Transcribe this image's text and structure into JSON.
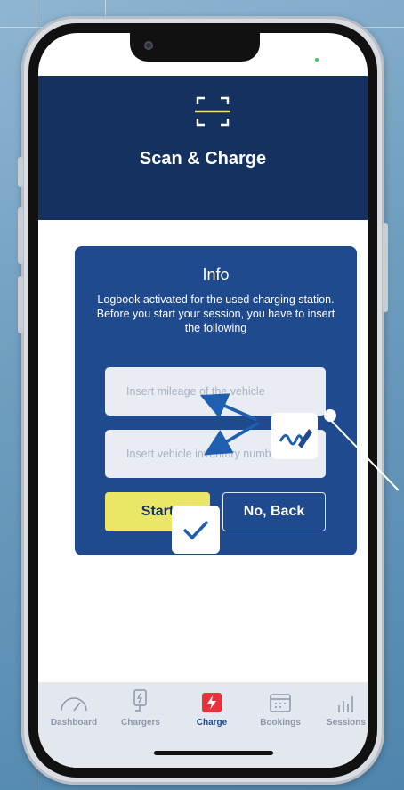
{
  "header": {
    "title": "Scan & Charge",
    "icon": "scan-frame-icon"
  },
  "card": {
    "title": "Info",
    "message": "Logbook activated for the used charging station. Before you start your session, you have to insert the following",
    "mileage_placeholder": "Insert mileage of the vehicle",
    "inventory_placeholder": "Insert vehicle inventory numb...",
    "start_label": "Start",
    "back_label": "No, Back"
  },
  "nav": {
    "items": [
      {
        "label": "Dashboard",
        "icon": "speedometer-icon"
      },
      {
        "label": "Chargers",
        "icon": "charger-icon"
      },
      {
        "label": "Charge",
        "icon": "lightning-icon"
      },
      {
        "label": "Bookings",
        "icon": "calendar-icon"
      },
      {
        "label": "Sessions",
        "icon": "bar-chart-icon"
      }
    ],
    "active": "Charge"
  },
  "colors": {
    "header_bg": "#143160",
    "card_bg": "#1f4a8e",
    "start_button": "#ece666",
    "active_nav": "#1f4a8e",
    "charge_icon_bg": "#e8313a"
  }
}
